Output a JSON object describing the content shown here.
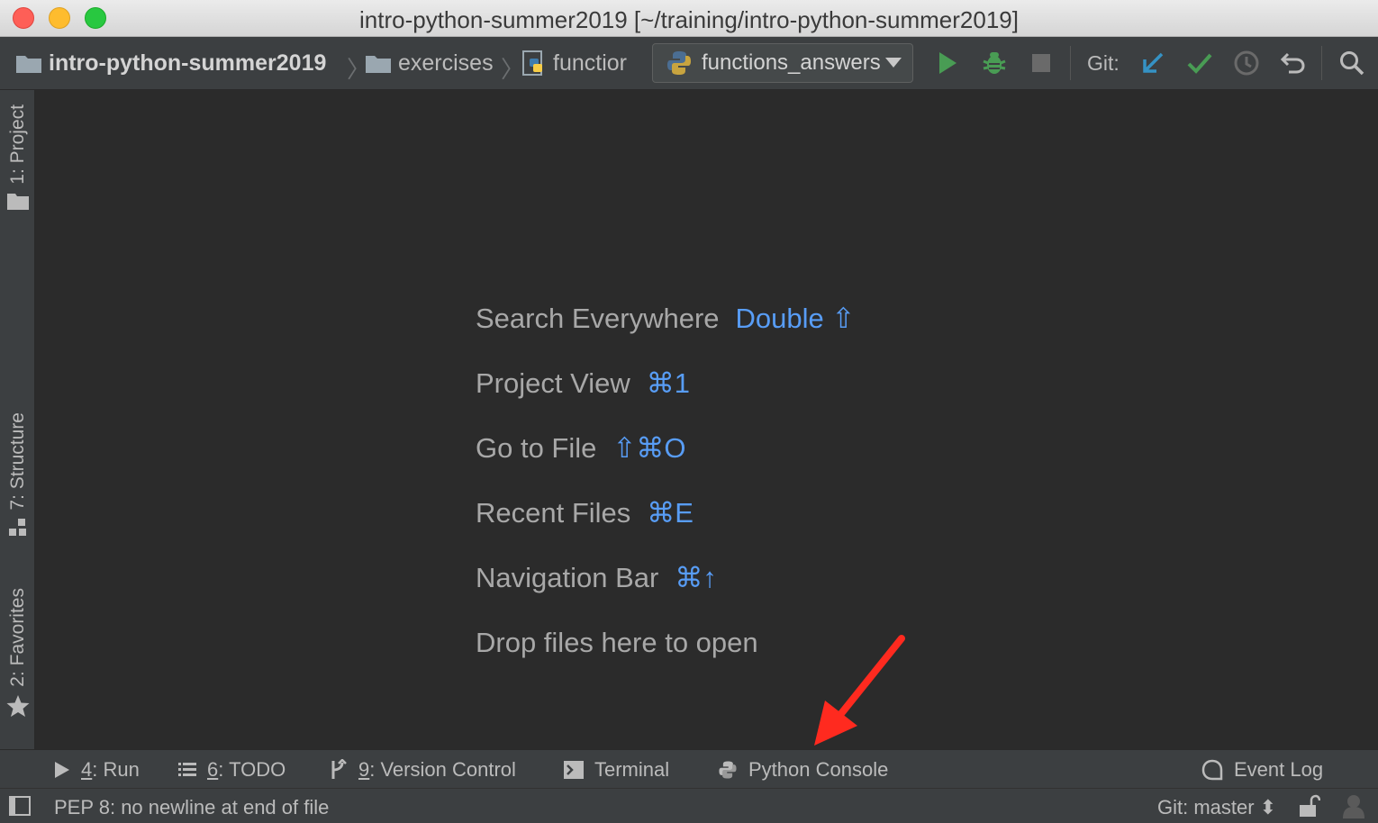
{
  "window": {
    "title": "intro-python-summer2019 [~/training/intro-python-summer2019]"
  },
  "breadcrumbs": [
    {
      "label": "intro-python-summer2019",
      "icon": "folder-icon"
    },
    {
      "label": "exercises",
      "icon": "folder-icon"
    },
    {
      "label": "functior",
      "icon": "python-file-icon"
    }
  ],
  "run_config": {
    "selected": "functions_answers",
    "icon": "python-icon"
  },
  "toolbar": {
    "run_icon": "run-icon",
    "debug_icon": "debug-icon",
    "stop_icon": "stop-icon",
    "git_label": "Git:",
    "git_update_icon": "git-update-icon",
    "git_commit_icon": "git-commit-icon",
    "git_history_icon": "history-icon",
    "git_revert_icon": "revert-icon",
    "search_icon": "search-icon",
    "colors": {
      "run": "#499c54",
      "debug": "#499c54",
      "git_update": "#3592c4",
      "git_commit": "#499c54"
    }
  },
  "left_tool_windows": [
    {
      "label": "1: Project",
      "icon": "folder-icon"
    },
    {
      "label": "7: Structure",
      "icon": "structure-icon"
    },
    {
      "label": "2: Favorites",
      "icon": "star-icon"
    }
  ],
  "editor_hints": [
    {
      "label": "Search Everywhere",
      "shortcut": "Double ⇧"
    },
    {
      "label": "Project View",
      "shortcut": "⌘1"
    },
    {
      "label": "Go to File",
      "shortcut": "⇧⌘O"
    },
    {
      "label": "Recent Files",
      "shortcut": "⌘E"
    },
    {
      "label": "Navigation Bar",
      "shortcut": "⌘↑"
    },
    {
      "label": "Drop files here to open",
      "shortcut": ""
    }
  ],
  "annotation": {
    "type": "arrow",
    "color": "#ff2a1f",
    "target": "Python Console"
  },
  "bottom_tool_windows": [
    {
      "num": "4",
      "label": ": Run",
      "icon": "run-icon"
    },
    {
      "num": "6",
      "label": ": TODO",
      "icon": "todo-icon"
    },
    {
      "num": "9",
      "label": ": Version Control",
      "icon": "version-control-icon"
    },
    {
      "num": "",
      "label": "Terminal",
      "icon": "terminal-icon"
    },
    {
      "num": "",
      "label": "Python Console",
      "icon": "python-icon"
    },
    {
      "num": "",
      "label": "Event Log",
      "icon": "event-log-icon"
    }
  ],
  "status_bar": {
    "message": "PEP 8: no newline at end of file",
    "git_branch": "Git: master ⬍",
    "lock_icon": "lock-icon",
    "inspector_icon": "hector-icon"
  }
}
